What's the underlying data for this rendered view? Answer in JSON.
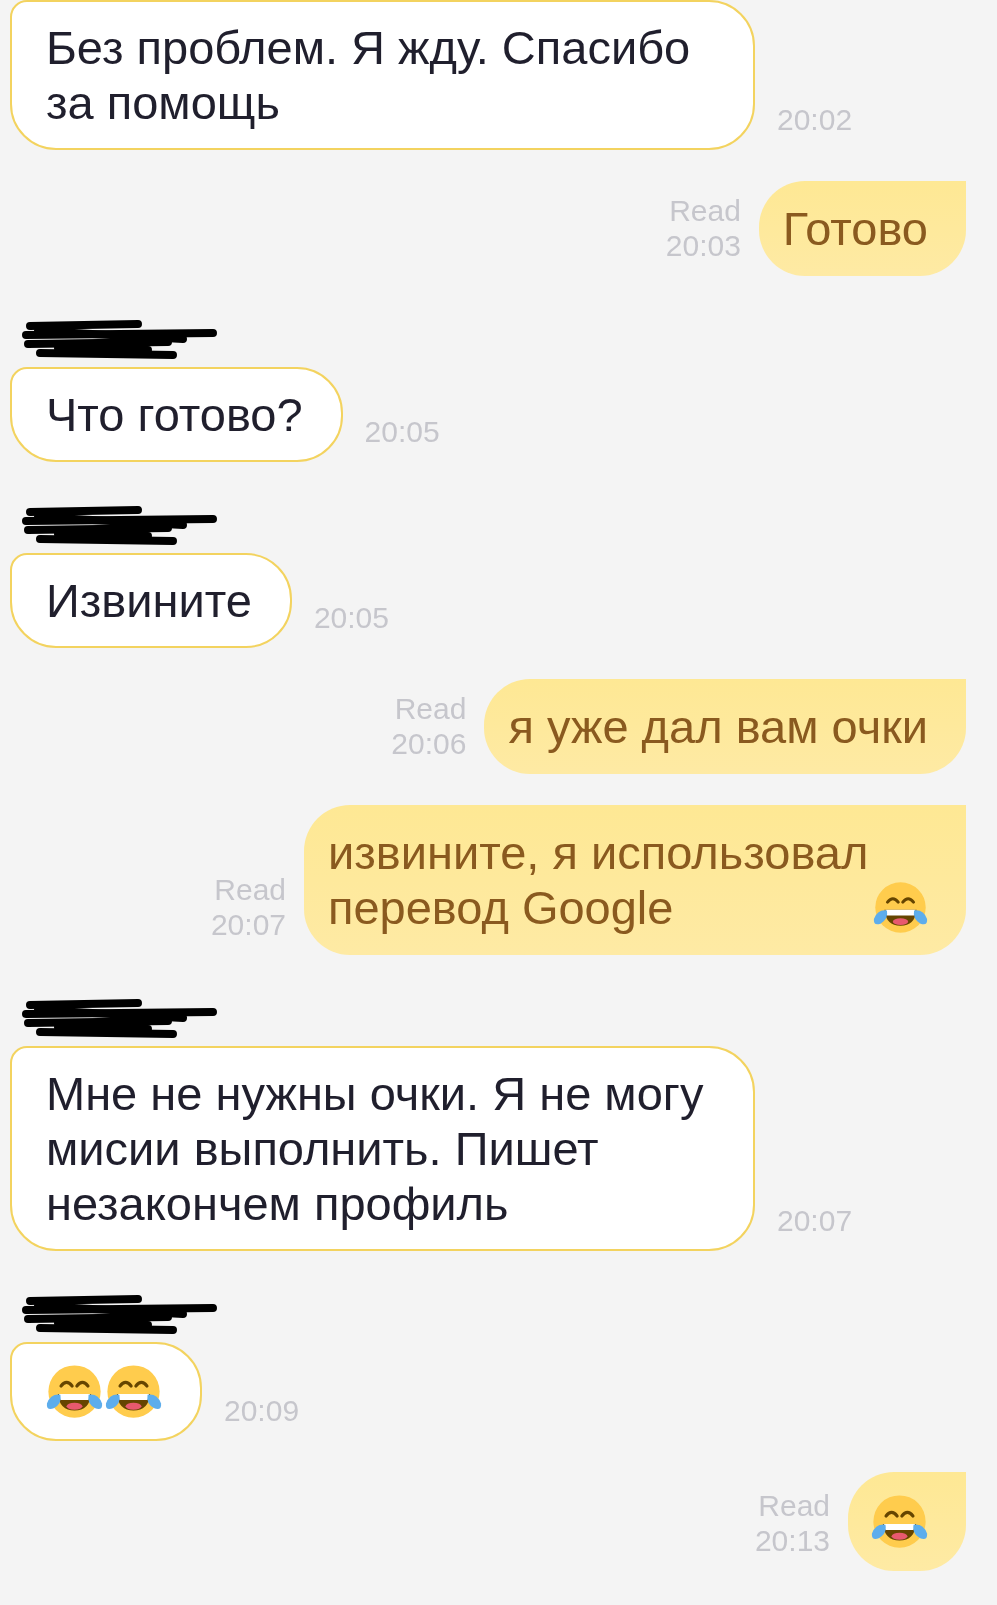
{
  "messages": [
    {
      "kind": "incoming",
      "parts": [
        {
          "kind": "text",
          "text": "Без проблем. Я жду. Спасибо за помощь"
        }
      ],
      "time": "20:02"
    },
    {
      "kind": "outgoing",
      "status": "Read",
      "parts": [
        {
          "kind": "text",
          "text": "Готово"
        }
      ],
      "time": "20:03"
    },
    {
      "kind": "incoming",
      "sender_redacted": true,
      "parts": [
        {
          "kind": "text",
          "text": "Что готово?"
        }
      ],
      "time": "20:05"
    },
    {
      "kind": "incoming",
      "sender_redacted": true,
      "parts": [
        {
          "kind": "text",
          "text": "Извините"
        }
      ],
      "time": "20:05"
    },
    {
      "kind": "outgoing",
      "status": "Read",
      "parts": [
        {
          "kind": "text",
          "text": "я уже дал вам очки"
        }
      ],
      "time": "20:06"
    },
    {
      "kind": "outgoing",
      "status": "Read",
      "parts": [
        {
          "kind": "text",
          "text": "извините, я использовал перевод Google"
        },
        {
          "kind": "emoji"
        }
      ],
      "time": "20:07"
    },
    {
      "kind": "incoming",
      "sender_redacted": true,
      "parts": [
        {
          "kind": "text",
          "text": "Мне не нужны очки. Я не могу мисии выполнить. Пишет незакончем профиль"
        }
      ],
      "time": "20:07"
    },
    {
      "kind": "incoming",
      "sender_redacted": true,
      "parts": [
        {
          "kind": "emoji"
        },
        {
          "kind": "emoji"
        }
      ],
      "time": "20:09"
    },
    {
      "kind": "outgoing",
      "status": "Read",
      "parts": [
        {
          "kind": "emoji"
        }
      ],
      "time": "20:13"
    }
  ]
}
